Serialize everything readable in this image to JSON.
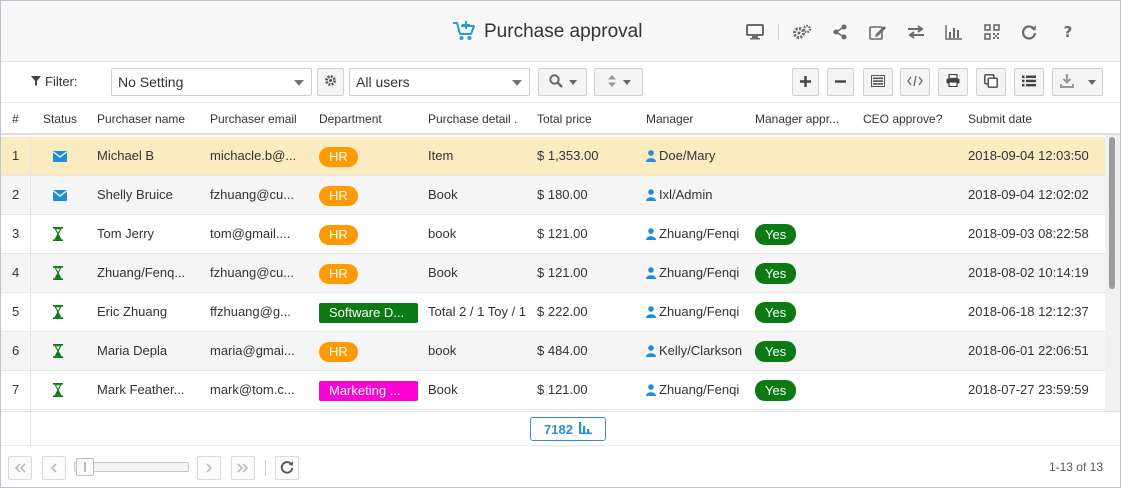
{
  "header": {
    "title": "Purchase approval",
    "icons": [
      "cart-icon",
      "monitor-icon",
      "gears-icon",
      "share-icon",
      "edit-icon",
      "swap-icon",
      "bar-chart-icon",
      "qr-code-icon",
      "refresh-icon",
      "help-icon"
    ]
  },
  "toolbar": {
    "filter_label": "Filter:",
    "filter_setting": "No Setting",
    "users_select": "All users"
  },
  "columns": [
    "#",
    "Status",
    "Purchaser name",
    "Purchaser email",
    "Department",
    "Purchase detail .",
    "Total price",
    "Manager",
    "Manager appr...",
    "CEO approve?",
    "Submit date"
  ],
  "rows": [
    {
      "num": "1",
      "status": "mail",
      "name": "Michael B",
      "email": "michacle.b@...",
      "dept": "HR",
      "detail": "Item",
      "price": "$ 1,353.00",
      "manager": "Doe/Mary",
      "mgr_approve": "",
      "ceo": "",
      "date": "2018-09-04 12:03:50"
    },
    {
      "num": "2",
      "status": "mail",
      "name": "Shelly Bruice",
      "email": "fzhuang@cu...",
      "dept": "HR",
      "detail": "Book",
      "price": "$ 180.00",
      "manager": "Ixl/Admin",
      "mgr_approve": "",
      "ceo": "",
      "date": "2018-09-04 12:02:02"
    },
    {
      "num": "3",
      "status": "pending",
      "name": "Tom Jerry",
      "email": "tom@gmail....",
      "dept": "HR",
      "detail": "book",
      "price": "$ 121.00",
      "manager": "Zhuang/Fenqi",
      "mgr_approve": "Yes",
      "ceo": "",
      "date": "2018-09-03 08:22:58"
    },
    {
      "num": "4",
      "status": "pending",
      "name": "Zhuang/Fenq...",
      "email": "fzhuang@cu...",
      "dept": "HR",
      "detail": "Book",
      "price": "$ 121.00",
      "manager": "Zhuang/Fenqi",
      "mgr_approve": "Yes",
      "ceo": "",
      "date": "2018-08-02 10:14:19"
    },
    {
      "num": "5",
      "status": "pending",
      "name": "Eric Zhuang",
      "email": "ffzhuang@g...",
      "dept": "Software D...",
      "detail": "Total 2 / 1 Toy / 1",
      "price": "$ 222.00",
      "manager": "Zhuang/Fenqi",
      "mgr_approve": "Yes",
      "ceo": "",
      "date": "2018-06-18 12:12:37"
    },
    {
      "num": "6",
      "status": "pending",
      "name": "Maria Depla",
      "email": "maria@gmai...",
      "dept": "HR",
      "detail": "book",
      "price": "$ 484.00",
      "manager": "Kelly/Clarkson",
      "mgr_approve": "Yes",
      "ceo": "",
      "date": "2018-06-01 22:06:51"
    },
    {
      "num": "7",
      "status": "pending",
      "name": "Mark Feather...",
      "email": "mark@tom.c...",
      "dept": "Marketing ...",
      "detail": "Book",
      "price": "$ 121.00",
      "manager": "Zhuang/Fenqi",
      "mgr_approve": "Yes",
      "ceo": "",
      "date": "2018-07-27 23:59:59"
    }
  ],
  "footer": {
    "count": "7182",
    "page_info": "1-13 of 13"
  },
  "colors": {
    "hr": "#ff9a00",
    "software": "#0b7a12",
    "marketing": "#ff00d4",
    "yes": "#0b7a12",
    "accent": "#2b8ed8",
    "selected_row": "#fbebc0"
  }
}
